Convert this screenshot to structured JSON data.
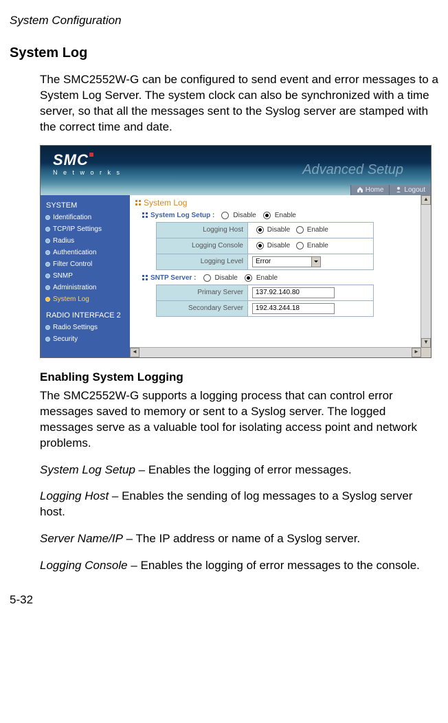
{
  "page_header": "System Configuration",
  "section_title": "System Log",
  "intro_para": "The SMC2552W-G can be configured to send event and error messages to a System Log Server. The system clock can also be synchronized with a time server, so that all the messages sent to the Syslog server are stamped with the correct time and date.",
  "screenshot": {
    "logo_main": "SMC",
    "logo_sub": "N e t w o r k s",
    "banner_text": "Advanced Setup",
    "tabs": {
      "home": "Home",
      "logout": "Logout"
    },
    "sidebar": {
      "group1_title": "SYSTEM",
      "group1_items": [
        "Identification",
        "TCP/IP Settings",
        "Radius",
        "Authentication",
        "Filter Control",
        "SNMP",
        "Administration",
        "System Log"
      ],
      "group2_title": "RADIO INTERFACE 2",
      "group2_items": [
        "Radio Settings",
        "Security"
      ]
    },
    "pane": {
      "title": "System Log",
      "syslog_label": "System Log Setup  :",
      "disable": "Disable",
      "enable": "Enable",
      "rows": {
        "logging_host": "Logging Host",
        "logging_console": "Logging Console",
        "logging_level": "Logging Level",
        "level_value": "Error"
      },
      "sntp_label": "SNTP Server  :",
      "sntp_rows": {
        "primary": "Primary Server",
        "primary_val": "137.92.140.80",
        "secondary": "Secondary Server",
        "secondary_val": "192.43.244.18"
      }
    }
  },
  "subsection_title": "Enabling System Logging",
  "sub_para": "The SMC2552W-G supports a logging process that can control error messages saved to memory or sent to a Syslog server. The logged messages serve as a valuable tool for isolating access point and network problems.",
  "defs": {
    "d1_term": "System Log Setup",
    "d1_text": " – Enables the logging of error messages.",
    "d2_term": "Logging Host",
    "d2_text": " – Enables the sending of log messages to a Syslog server host.",
    "d3_term": "Server Name/IP",
    "d3_text": " – The IP address or name of a Syslog server.",
    "d4_term": "Logging Console",
    "d4_text": " – Enables the logging of error messages to the console."
  },
  "page_number": "5-32"
}
